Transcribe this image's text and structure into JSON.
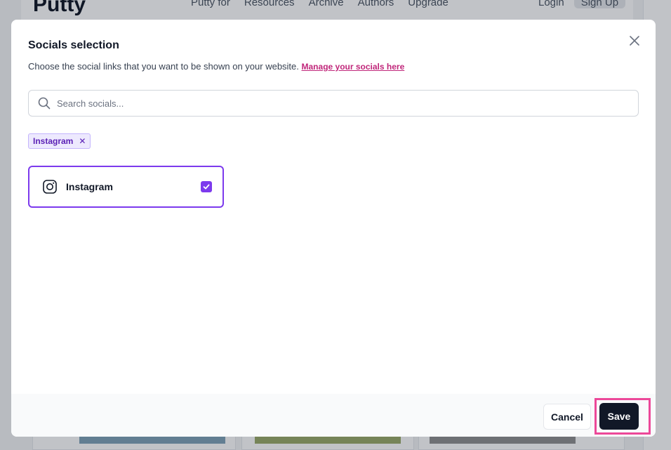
{
  "background": {
    "logo": "Putty",
    "nav_links": [
      "Putty for",
      "Resources",
      "Archive",
      "Authors",
      "Upgrade"
    ],
    "login_label": "Login",
    "signup_label": "Sign Up"
  },
  "modal": {
    "title": "Socials selection",
    "description": "Choose the social links that you want to be shown on your website.",
    "manage_link": "Manage your socials here",
    "search": {
      "placeholder": "Search socials...",
      "value": ""
    },
    "selected_tags": [
      {
        "label": "Instagram",
        "remove_glyph": "✕"
      }
    ],
    "socials": [
      {
        "name": "Instagram",
        "icon": "instagram-icon",
        "checked": true
      }
    ],
    "footer": {
      "cancel_label": "Cancel",
      "save_label": "Save"
    }
  },
  "colors": {
    "accent": "#7c3aed",
    "link": "#c0267a",
    "primary_button": "#111827",
    "highlight": "#ec4899"
  }
}
